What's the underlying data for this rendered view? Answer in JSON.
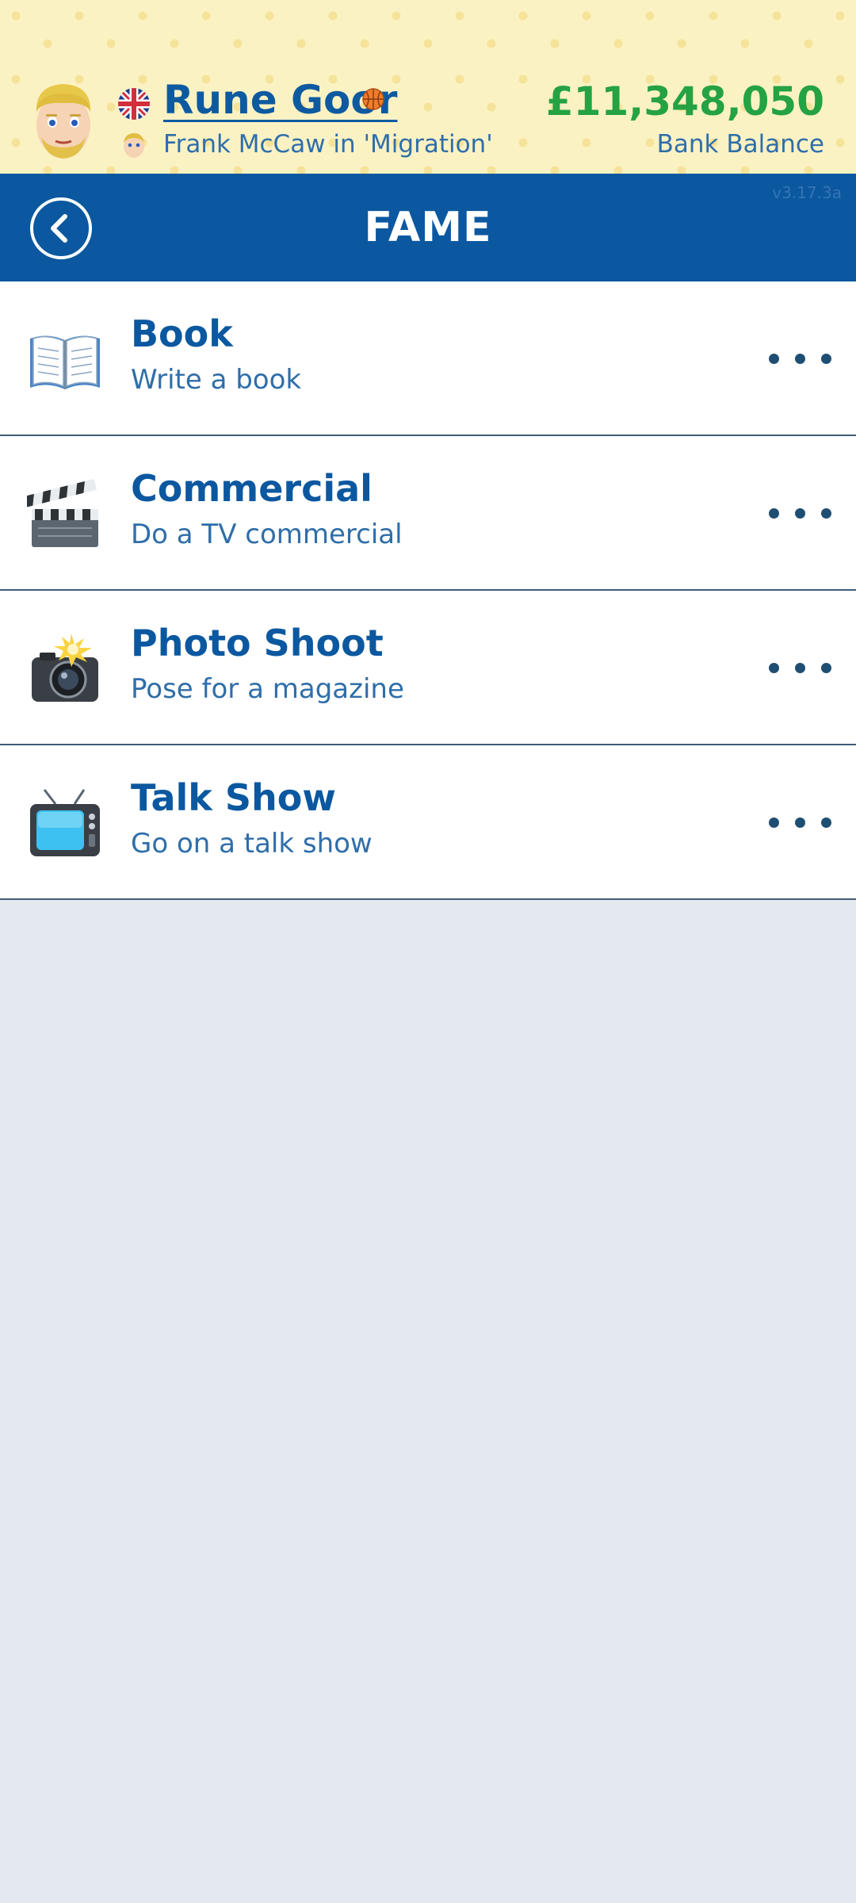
{
  "header": {
    "player_name": "Rune Goor",
    "role": "Frank McCaw in 'Migration'",
    "balance": "£11,348,050",
    "balance_label": "Bank Balance",
    "flag_icon": "uk-flag-icon",
    "ball_icon": "basketball-icon"
  },
  "title_bar": {
    "title": "FAME",
    "version": "v3.17.3a"
  },
  "items": [
    {
      "title": "Book",
      "subtitle": "Write a book",
      "icon": "book-icon"
    },
    {
      "title": "Commercial",
      "subtitle": "Do a TV commercial",
      "icon": "clapperboard-icon"
    },
    {
      "title": "Photo Shoot",
      "subtitle": "Pose for a magazine",
      "icon": "camera-flash-icon"
    },
    {
      "title": "Talk Show",
      "subtitle": "Go on a talk show",
      "icon": "television-icon"
    }
  ],
  "colors": {
    "header_bg": "#fbf2c4",
    "title_bar_bg": "#0b58a0",
    "balance_green": "#25a243",
    "text_blue": "#0b58a0",
    "page_bg": "#e4e9ef"
  }
}
